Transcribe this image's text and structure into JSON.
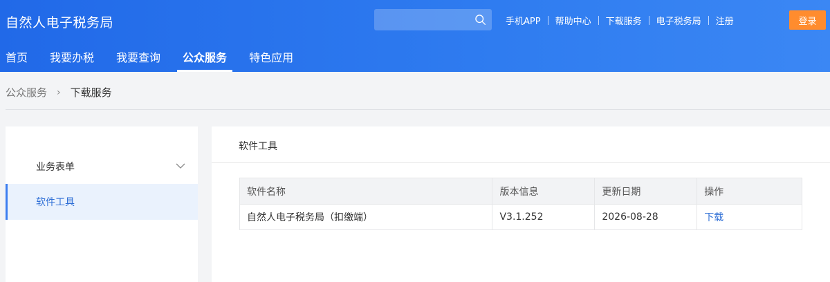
{
  "header": {
    "brand": "自然人电子税务局",
    "search": {
      "placeholder": "",
      "value": ""
    },
    "links": [
      "手机APP",
      "帮助中心",
      "下载服务",
      "电子税务局",
      "注册"
    ],
    "login_label": "登录",
    "colors": {
      "header_blue": "#2f7cf0",
      "login_orange": "#ff8c2e"
    }
  },
  "nav": {
    "tabs": [
      {
        "label": "首页",
        "active": false
      },
      {
        "label": "我要办税",
        "active": false
      },
      {
        "label": "我要查询",
        "active": false
      },
      {
        "label": "公众服务",
        "active": true
      },
      {
        "label": "特色应用",
        "active": false
      }
    ]
  },
  "breadcrumb": [
    "公众服务",
    "下载服务"
  ],
  "sidebar": {
    "group_label": "业务表单",
    "selected_label": "软件工具"
  },
  "main": {
    "title": "软件工具",
    "table": {
      "headers": [
        "软件名称",
        "版本信息",
        "更新日期",
        "操作"
      ],
      "rows": [
        {
          "name": "自然人电子税务局（扣缴端）",
          "version": "V3.1.252",
          "date": "2026-08-28",
          "action": "下载"
        }
      ]
    }
  },
  "icons": {
    "search": "search-icon",
    "chevron": "chevron-down-icon",
    "breadcrumb_sep": "chevron-right-icon"
  }
}
